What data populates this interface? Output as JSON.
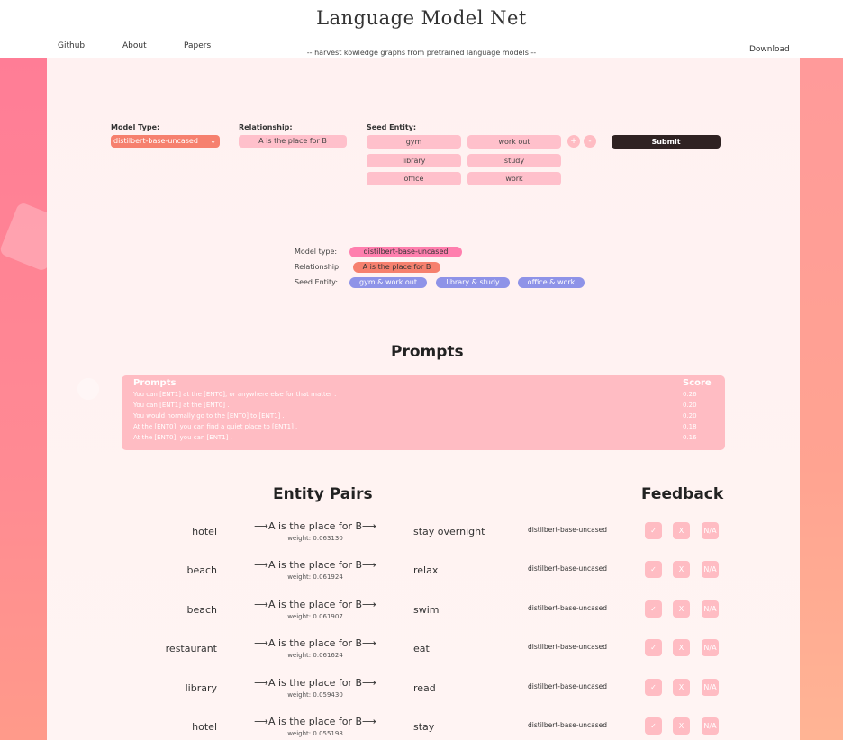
{
  "header": {
    "title": "Language Model Net",
    "tagline": "-- harvest kowledge graphs from pretrained language models --",
    "nav": [
      "Github",
      "About",
      "Papers"
    ],
    "download": "Download"
  },
  "form": {
    "model_type_label": "Model Type:",
    "model_type_value": "distilbert-base-uncased",
    "relationship_label": "Relationship:",
    "relationship_value": "A is the place for B",
    "seed_entity_label": "Seed Entity:",
    "seed_pairs": [
      [
        "gym",
        "work out"
      ],
      [
        "library",
        "study"
      ],
      [
        "office",
        "work"
      ]
    ],
    "add_symbol": "+",
    "remove_symbol": "-",
    "submit": "Submit"
  },
  "summary": {
    "model_type_label": "Model type:",
    "model_type_value": "distilbert-base-uncased",
    "relationship_label": "Relationship:",
    "relationship_value": "A is the place for B",
    "seed_entity_label": "Seed Entity:",
    "seed_tags": [
      "gym & work out",
      "library & study",
      "office & work"
    ]
  },
  "prompts": {
    "title": "Prompts",
    "col_prompt": "Prompts",
    "col_score": "Score",
    "rows": [
      {
        "prompt": "You can [ENT1] at the [ENT0], or anywhere else for that matter .",
        "score": "0.26"
      },
      {
        "prompt": "You can [ENT1] at the [ENT0] .",
        "score": "0.20"
      },
      {
        "prompt": "You would normally go to the [ENT0] to [ENT1] .",
        "score": "0.20"
      },
      {
        "prompt": "At the [ENT0], you can find a quiet place to [ENT1] .",
        "score": "0.18"
      },
      {
        "prompt": "At the [ENT0], you can [ENT1] .",
        "score": "0.16"
      }
    ]
  },
  "entity_pairs": {
    "title": "Entity Pairs",
    "feedback_title": "Feedback",
    "feedback_buttons": [
      "✓",
      "X",
      "N/A"
    ],
    "rows": [
      {
        "head": "hotel",
        "relation": "⟶A is the place for B⟶",
        "weight": "weight: 0.063130",
        "tail": "stay overnight",
        "model": "distilbert-base-uncased"
      },
      {
        "head": "beach",
        "relation": "⟶A is the place for B⟶",
        "weight": "weight: 0.061924",
        "tail": "relax",
        "model": "distilbert-base-uncased"
      },
      {
        "head": "beach",
        "relation": "⟶A is the place for B⟶",
        "weight": "weight: 0.061907",
        "tail": "swim",
        "model": "distilbert-base-uncased"
      },
      {
        "head": "restaurant",
        "relation": "⟶A is the place for B⟶",
        "weight": "weight: 0.061624",
        "tail": "eat",
        "model": "distilbert-base-uncased"
      },
      {
        "head": "library",
        "relation": "⟶A is the place for B⟶",
        "weight": "weight: 0.059430",
        "tail": "read",
        "model": "distilbert-base-uncased"
      },
      {
        "head": "hotel",
        "relation": "⟶A is the place for B⟶",
        "weight": "weight: 0.055198",
        "tail": "stay",
        "model": "distilbert-base-uncased"
      }
    ]
  },
  "colors": {
    "accent_pink": "#ffbcc3",
    "accent_orange": "#f6806e",
    "accent_blue": "#8e93e8",
    "submit_dark": "#2f2222"
  }
}
